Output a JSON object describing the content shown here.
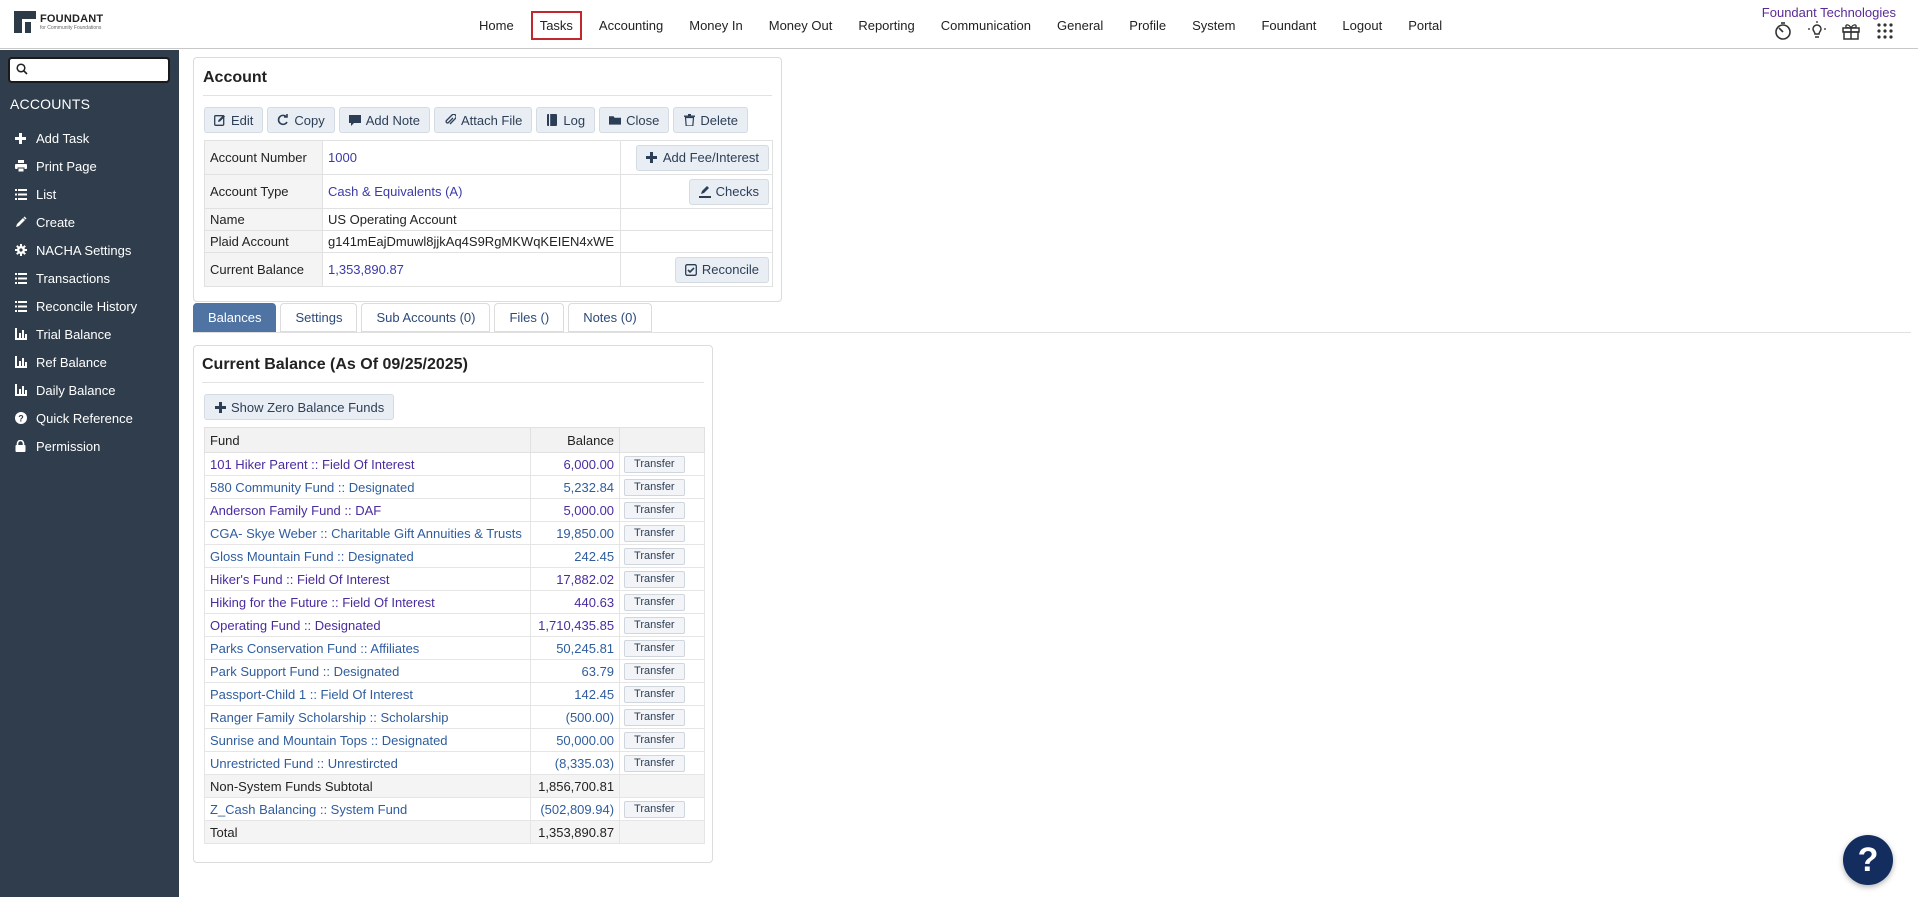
{
  "logo": {
    "name": "FOUNDANT",
    "tagline": "for Community Foundations"
  },
  "nav": {
    "items": [
      "Home",
      "Tasks",
      "Accounting",
      "Money In",
      "Money Out",
      "Reporting",
      "Communication",
      "General",
      "Profile",
      "System",
      "Foundant",
      "Logout",
      "Portal"
    ],
    "active": "Tasks"
  },
  "org_name": "Foundant Technologies",
  "top_icons": [
    "timer-icon",
    "lightbulb-icon",
    "gift-icon",
    "apps-grid-icon"
  ],
  "sidebar": {
    "search": {
      "value": "",
      "placeholder": ""
    },
    "title": "ACCOUNTS",
    "items": [
      {
        "label": "Add Task",
        "icon": "plus-icon"
      },
      {
        "label": "Print Page",
        "icon": "printer-icon"
      },
      {
        "label": "List",
        "icon": "list-icon"
      },
      {
        "label": "Create",
        "icon": "pencil-icon"
      },
      {
        "label": "NACHA Settings",
        "icon": "gear-icon"
      },
      {
        "label": "Transactions",
        "icon": "list-icon"
      },
      {
        "label": "Reconcile History",
        "icon": "list-icon"
      },
      {
        "label": "Trial Balance",
        "icon": "bar-chart-icon"
      },
      {
        "label": "Ref Balance",
        "icon": "bar-chart-icon"
      },
      {
        "label": "Daily Balance",
        "icon": "bar-chart-icon"
      },
      {
        "label": "Quick Reference",
        "icon": "question-circle-icon"
      },
      {
        "label": "Permission",
        "icon": "lock-icon"
      }
    ]
  },
  "account": {
    "title": "Account",
    "actions": [
      "Edit",
      "Copy",
      "Add Note",
      "Attach File",
      "Log",
      "Close",
      "Delete"
    ],
    "fields": {
      "number_label": "Account Number",
      "number": "1000",
      "type_label": "Account Type",
      "type": "Cash & Equivalents (A)",
      "name_label": "Name",
      "name": "US Operating Account",
      "plaid_label": "Plaid Account",
      "plaid": "g141mEajDmuwl8jjkAq4S9RgMKWqKEIEN4xWE",
      "balance_label": "Current Balance",
      "balance": "1,353,890.87"
    },
    "side_buttons": {
      "fee": "Add Fee/Interest",
      "checks": "Checks",
      "reconcile": "Reconcile"
    }
  },
  "tabs": [
    "Balances",
    "Settings",
    "Sub Accounts (0)",
    "Files ()",
    "Notes (0)"
  ],
  "active_tab": "Balances",
  "balances": {
    "title": "Current Balance (As Of 09/25/2025)",
    "show_zero": "Show Zero Balance Funds",
    "headers": {
      "fund": "Fund",
      "balance": "Balance"
    },
    "transfer_label": "Transfer",
    "rows": [
      {
        "fund": "101 Hiker Parent :: Field Of Interest",
        "balance": "6,000.00",
        "visited": true
      },
      {
        "fund": "580 Community Fund :: Designated",
        "balance": "5,232.84",
        "visited": false
      },
      {
        "fund": "Anderson Family Fund :: DAF",
        "balance": "5,000.00",
        "visited": true
      },
      {
        "fund": "CGA- Skye Weber :: Charitable Gift Annuities & Trusts",
        "balance": "19,850.00",
        "visited": false
      },
      {
        "fund": "Gloss Mountain Fund :: Designated",
        "balance": "242.45",
        "visited": false
      },
      {
        "fund": "Hiker's Fund :: Field Of Interest",
        "balance": "17,882.02",
        "visited": true
      },
      {
        "fund": "Hiking for the Future :: Field Of Interest",
        "balance": "440.63",
        "visited": true
      },
      {
        "fund": "Operating Fund :: Designated",
        "balance": "1,710,435.85",
        "visited": true
      },
      {
        "fund": "Parks Conservation Fund :: Affiliates",
        "balance": "50,245.81",
        "visited": false
      },
      {
        "fund": "Park Support Fund :: Designated",
        "balance": "63.79",
        "visited": false
      },
      {
        "fund": "Passport-Child 1 :: Field Of Interest",
        "balance": "142.45",
        "visited": false
      },
      {
        "fund": "Ranger Family Scholarship :: Scholarship",
        "balance": "(500.00)",
        "visited": false
      },
      {
        "fund": "Sunrise and Mountain Tops :: Designated",
        "balance": "50,000.00",
        "visited": false
      },
      {
        "fund": "Unrestricted Fund :: Unrestircted",
        "balance": "(8,335.03)",
        "visited": false
      }
    ],
    "subtotal": {
      "label": "Non-System Funds Subtotal",
      "balance": "1,856,700.81"
    },
    "system_row": {
      "fund": "Z_Cash Balancing :: System Fund",
      "balance": "(502,809.94)"
    },
    "total": {
      "label": "Total",
      "balance": "1,353,890.87"
    }
  },
  "help_label": "?",
  "colors": {
    "sidebar_bg": "#2f3d4c",
    "tab_active": "#4f73a3",
    "link_blue": "#2f5d9e",
    "link_purple": "#4a2ba0",
    "active_nav_border": "#c0282d",
    "help_bg": "#132d5e"
  }
}
